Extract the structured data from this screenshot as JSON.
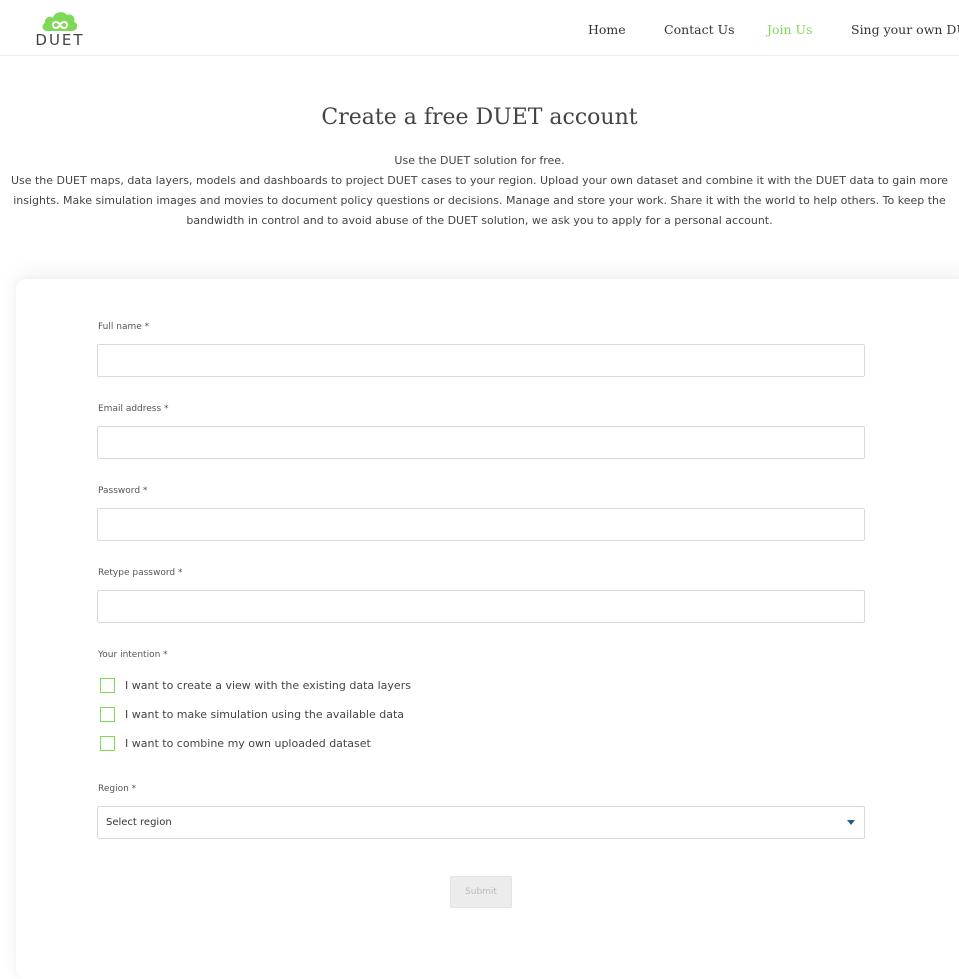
{
  "header": {
    "logo_text": "DUET",
    "nav": [
      {
        "label": "Home"
      },
      {
        "label": "Contact Us"
      },
      {
        "label": "Join Us",
        "active": true
      },
      {
        "label": "Sing your own DUET"
      }
    ]
  },
  "intro": {
    "title": "Create a free DUET account",
    "lead": "Use the DUET solution for free.",
    "body": "Use the DUET maps, data layers, models and dashboards to project DUET cases to your region. Upload your own dataset and combine it with the DUET data to gain more insights. Make simulation images and movies to document policy questions or decisions. Manage and store your work. Share it with the world to help others. To keep the bandwidth in control and to avoid abuse of the DUET solution, we ask you to apply for a personal account."
  },
  "form": {
    "full_name_label": "Full name *",
    "full_name_value": "",
    "email_label": "Email address *",
    "email_value": "",
    "password_label": "Password *",
    "password_value": "",
    "retype_label": "Retype password *",
    "retype_value": "",
    "intention_label": "Your intention *",
    "intentions": [
      {
        "label": "I want to create a view with the existing data layers",
        "checked": false
      },
      {
        "label": "I want to make simulation using the available data",
        "checked": false
      },
      {
        "label": "I want to combine my own uploaded dataset",
        "checked": false
      }
    ],
    "region_label": "Region *",
    "region_selected": "Select region",
    "submit_label": "Submit"
  },
  "colors": {
    "accent_green": "#7ed957",
    "select_arrow": "#1f5f8b"
  },
  "icons": {
    "logo": "cloud-infinity-icon",
    "dropdown": "caret-down-icon"
  }
}
